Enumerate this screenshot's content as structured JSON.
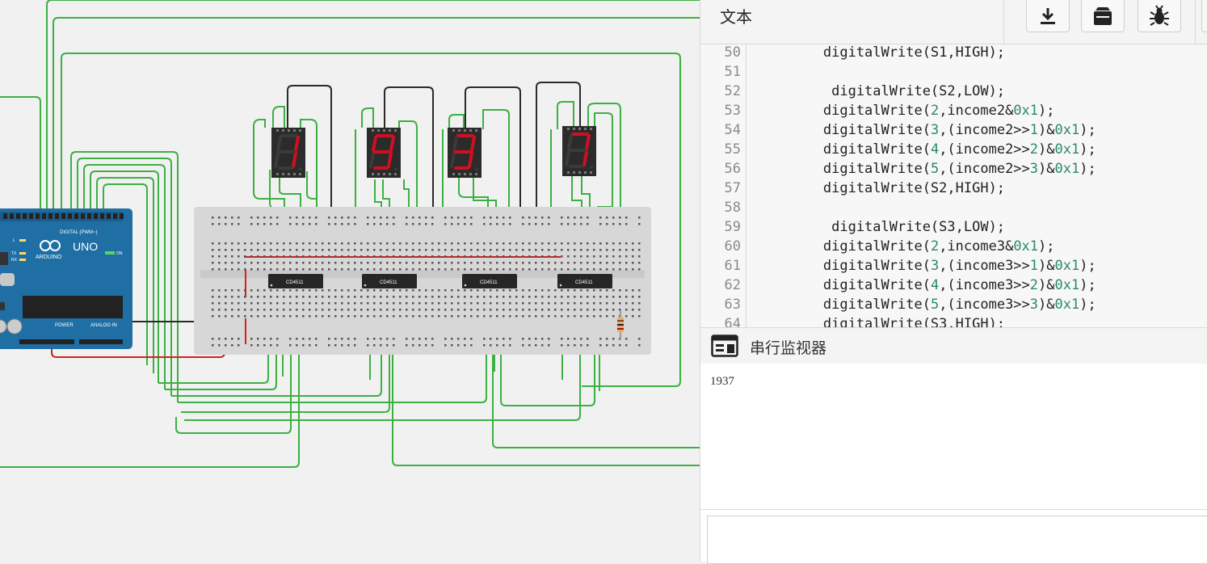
{
  "editor": {
    "mode_label": "文本",
    "toolbar": {
      "download_icon": "download-icon",
      "library_icon": "library-icon",
      "debug_icon": "bug-icon"
    },
    "lines": [
      {
        "n": "50",
        "text": "        digitalWrite(S1,HIGH);"
      },
      {
        "n": "51",
        "text": ""
      },
      {
        "n": "52",
        "text": "         digitalWrite(S2,LOW);"
      },
      {
        "n": "53",
        "text": "        digitalWrite(2,income2&0x1);"
      },
      {
        "n": "54",
        "text": "        digitalWrite(3,(income2>>1)&0x1);"
      },
      {
        "n": "55",
        "text": "        digitalWrite(4,(income2>>2)&0x1);"
      },
      {
        "n": "56",
        "text": "        digitalWrite(5,(income2>>3)&0x1);"
      },
      {
        "n": "57",
        "text": "        digitalWrite(S2,HIGH);"
      },
      {
        "n": "58",
        "text": ""
      },
      {
        "n": "59",
        "text": "         digitalWrite(S3,LOW);"
      },
      {
        "n": "60",
        "text": "        digitalWrite(2,income3&0x1);"
      },
      {
        "n": "61",
        "text": "        digitalWrite(3,(income3>>1)&0x1);"
      },
      {
        "n": "62",
        "text": "        digitalWrite(4,(income3>>2)&0x1);"
      },
      {
        "n": "63",
        "text": "        digitalWrite(5,(income3>>3)&0x1);"
      },
      {
        "n": "64",
        "text": "        digitalWrite(S3,HIGH);"
      }
    ]
  },
  "serial": {
    "title": "串行监视器",
    "output": "1937",
    "input_value": ""
  },
  "circuit": {
    "board_name": "UNO",
    "board_brand": "ARDUINO",
    "digital_label": "DIGITAL (PWM~)",
    "power_label": "POWER",
    "analog_label": "ANALOG IN",
    "on_label": "ON",
    "led_labels": [
      "L",
      "TX",
      "RX"
    ],
    "chip_label": "CD4511",
    "display_digits": [
      "1",
      "9",
      "3",
      "7"
    ],
    "segment_on_color": "#d01020",
    "segment_off_color": "#3a3a3a",
    "wire_color": "#3cb043"
  }
}
